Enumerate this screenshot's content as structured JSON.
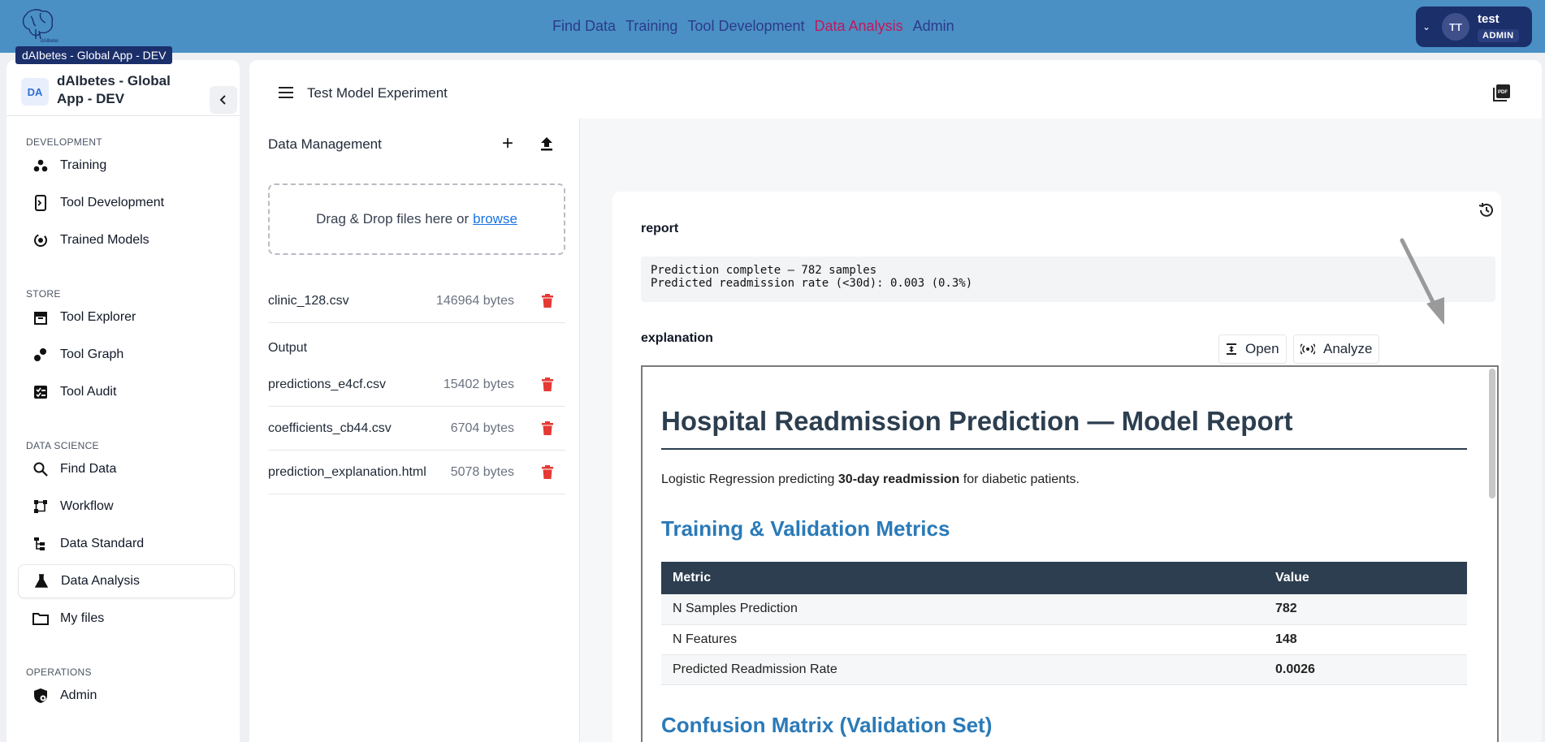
{
  "topbar": {
    "env_tooltip": "dAIbetes - Global App - DEV",
    "nav": [
      "Find Data",
      "Training",
      "Tool Development",
      "Data Analysis",
      "Admin"
    ],
    "active_nav": "Data Analysis",
    "user": {
      "initials": "TT",
      "name": "test",
      "role": "ADMIN"
    },
    "brand_color": "#4a90c4",
    "active_color": "#c2185b"
  },
  "sidebar": {
    "badge": "DA",
    "title": "dAIbetes - Global App - DEV",
    "sections": {
      "development": "DEVELOPMENT",
      "store": "STORE",
      "data_science": "DATA SCIENCE",
      "operations": "OPERATIONS"
    },
    "items": {
      "training": "Training",
      "tool_development": "Tool Development",
      "trained_models": "Trained Models",
      "tool_explorer": "Tool Explorer",
      "tool_graph": "Tool Graph",
      "tool_audit": "Tool Audit",
      "find_data": "Find Data",
      "workflow": "Workflow",
      "data_standard": "Data Standard",
      "data_analysis": "Data Analysis",
      "my_files": "My files",
      "admin": "Admin"
    },
    "active_item": "Data Analysis"
  },
  "main": {
    "title": "Test Model Experiment",
    "data_management": {
      "title": "Data Management",
      "dropzone_text": "Drag & Drop files here or",
      "dropzone_link": "browse",
      "input_files": [
        {
          "name": "clinic_128.csv",
          "size": "146964 bytes"
        }
      ],
      "output_label": "Output",
      "output_files": [
        {
          "name": "predictions_e4cf.csv",
          "size": "15402 bytes"
        },
        {
          "name": "coefficients_cb44.csv",
          "size": "6704 bytes"
        },
        {
          "name": "prediction_explanation.html",
          "size": "5078 bytes"
        }
      ]
    },
    "result": {
      "report_label": "report",
      "report_text": "Prediction complete — 782 samples\nPredicted readmission rate (<30d): 0.003 (0.3%)",
      "explanation_label": "explanation",
      "open_button": "Open",
      "analyze_button": "Analyze",
      "doc": {
        "h1": "Hospital Readmission Prediction — Model Report",
        "intro_before": "Logistic Regression predicting",
        "intro_bold": "30-day readmission",
        "intro_after": "for diabetic patients.",
        "metrics_heading": "Training & Validation Metrics",
        "table_headers": [
          "Metric",
          "Value"
        ],
        "table_rows": [
          [
            "N Samples Prediction",
            "782"
          ],
          [
            "N Features",
            "148"
          ],
          [
            "Predicted Readmission Rate",
            "0.0026"
          ]
        ],
        "confusion_heading": "Confusion Matrix (Validation Set)"
      }
    }
  }
}
